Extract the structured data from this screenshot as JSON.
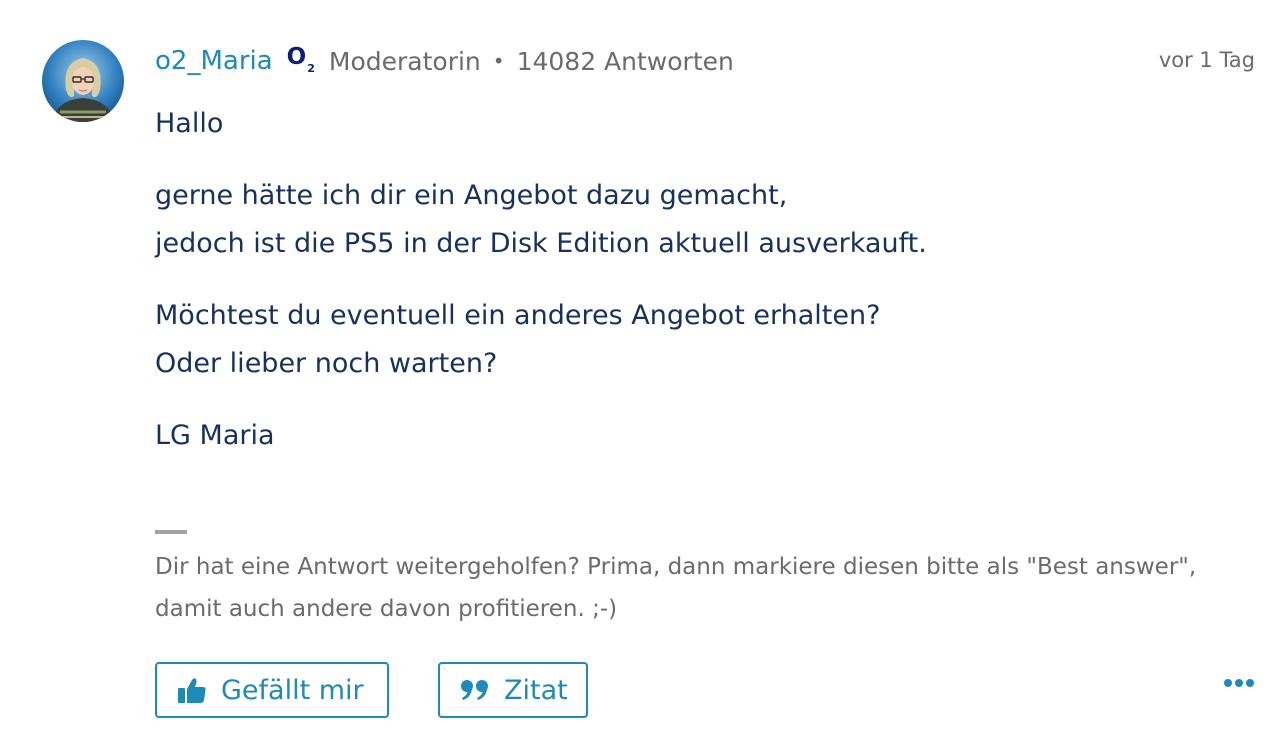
{
  "post": {
    "author": "o2_Maria",
    "brand_logo": "O",
    "brand_logo_sub": "2",
    "role": "Moderatorin",
    "separator": "•",
    "answers": "14082 Antworten",
    "timestamp": "vor 1 Tag",
    "body": {
      "p1": "Hallo",
      "p2_line1": "gerne hätte ich dir ein Angebot dazu gemacht,",
      "p2_line2": "jedoch ist die PS5 in der Disk Edition aktuell ausverkauft.",
      "p3_line1": "Möchtest du eventuell ein anderes Angebot erhalten?",
      "p3_line2": "Oder lieber noch warten?",
      "p4": "LG Maria"
    },
    "signature_line1": "Dir hat eine Antwort weitergeholfen? Prima, dann markiere diesen bitte als \"Best answer\",",
    "signature_line2": "damit auch andere davon profitieren. ;-)"
  },
  "actions": {
    "like_label": "Gefällt mir",
    "quote_label": "Zitat",
    "like_icon": "thumbs-up-icon",
    "quote_icon": "quote-icon",
    "more_icon": "more-options-icon"
  },
  "colors": {
    "accent": "#1e8ab8",
    "body_text": "#17315c",
    "muted_text": "#6b6b6b",
    "brand": "#0b1e7a"
  }
}
